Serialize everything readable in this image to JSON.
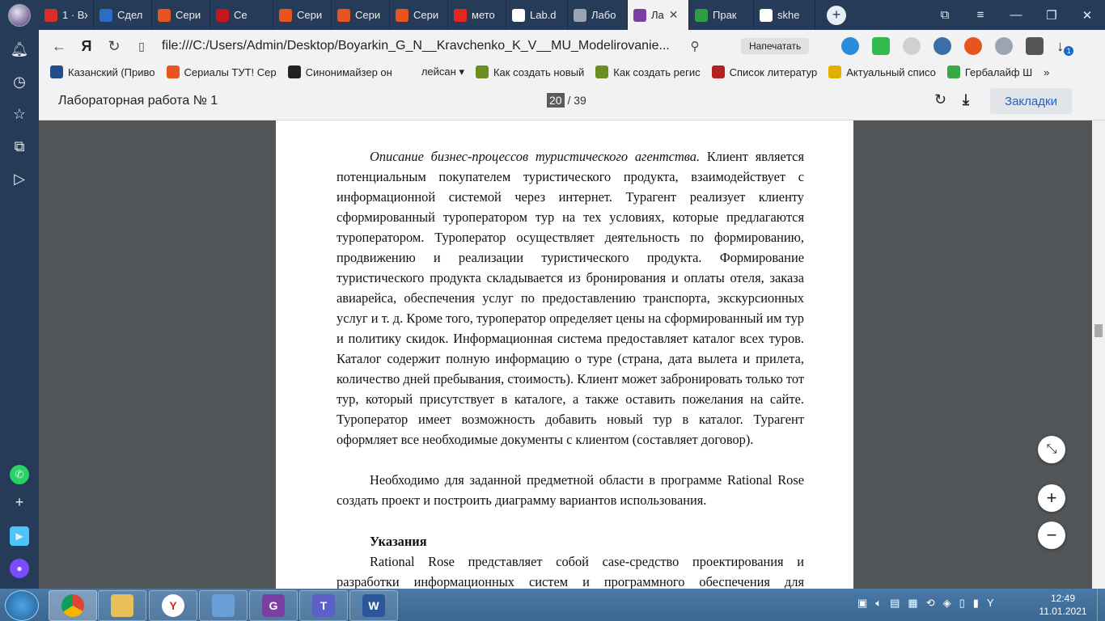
{
  "tabs": [
    {
      "label": "1 · Вх",
      "icon": "gmail-icon",
      "color": "#d93025"
    },
    {
      "label": "Сдел",
      "icon": "24-icon",
      "color": "#2b6cc4"
    },
    {
      "label": "Сери",
      "icon": "cat-icon",
      "color": "#e8541e"
    },
    {
      "label": "Се",
      "icon": "red-book-icon",
      "color": "#c4161c"
    },
    {
      "label": "Сери",
      "icon": "cat-icon",
      "color": "#e8541e"
    },
    {
      "label": "Сери",
      "icon": "cat-icon",
      "color": "#e8541e"
    },
    {
      "label": "Сери",
      "icon": "cat-icon",
      "color": "#e8541e"
    },
    {
      "label": "мето",
      "icon": "yandex-icon",
      "color": "#e52620"
    },
    {
      "label": "Lab.d",
      "icon": "doc-icon",
      "color": "#ffffff"
    },
    {
      "label": "Лабо",
      "icon": "globe-icon",
      "color": "#9aa5b1"
    },
    {
      "label": "Ла",
      "icon": "pdf-icon",
      "color": "#7b3fa0",
      "active": true
    },
    {
      "label": "Прак",
      "icon": "check-icon",
      "color": "#2e9e44"
    },
    {
      "label": "skhe",
      "icon": "doc-icon",
      "color": "#ffffff"
    }
  ],
  "address": {
    "url": "file:///C:/Users/Admin/Desktop/Boyarkin_G_N__Kravchenko_K_V__MU_Modelirovanie...",
    "print_label": "Напечатать",
    "downloads_badge": "1"
  },
  "bookmarks": [
    {
      "label": "Казанский (Приво",
      "color": "#1f4e8c"
    },
    {
      "label": "Сериалы ТУТ! Сер",
      "color": "#e8541e"
    },
    {
      "label": "Синонимайзер он",
      "color": "#222222"
    },
    {
      "label": "лейсан ▾",
      "color": "#f2f2f2"
    },
    {
      "label": "Как создать новый",
      "color": "#6b8e23"
    },
    {
      "label": "Как создать регис",
      "color": "#6b8e23"
    },
    {
      "label": "Список литератур",
      "color": "#b22222"
    },
    {
      "label": "Актуальный списо",
      "color": "#e0b000"
    },
    {
      "label": "Гербалайф Ш",
      "color": "#3aa845"
    }
  ],
  "pdf": {
    "title": "Лабораторная работа № 1",
    "page_current": "20",
    "page_total": "/ 39",
    "bookmarks_label": "Закладки"
  },
  "document": {
    "para1_em": "Описание бизнес-процессов туристического агентства.",
    "para1": " Клиент является потенциальным покупателем туристического продукта, взаимодействует с информационной системой через интернет. Турагент реализует клиенту сформированный туроператором тур на тех условиях, которые предлагаются туроператором. Туроператор осуществляет деятельность по формированию, продвижению и реализации туристического продукта. Формирование туристического продукта складывается из бронирования и оплаты отеля, заказа авиарейса, обеспечения услуг по предоставлению транспорта, экскурсионных услуг и т. д. Кроме того, туроператор определяет цены на сформированный им тур и политику скидок. Информационная система предоставляет каталог всех туров. Каталог содержит полную информацию о туре (страна, дата вылета и прилета, количество дней пребывания, стоимость). Клиент может забронировать только тот тур, который присутствует в каталоге, а также оставить пожелания на сайте. Туроператор имеет возможность добавить новый тур в каталог. Турагент оформляет все необходимые документы с клиентом (составляет договор).",
    "para2": "Необходимо для заданной предметной области в программе Rational Rose создать проект и построить диаграмму вариантов использования.",
    "heading": "Указания",
    "para3": "Rational Rose представляет собой case-средство проектирования и разработки информационных систем и программного обеспечения для управления"
  },
  "taskbar": {
    "time": "12:49",
    "date": "11.01.2021"
  }
}
